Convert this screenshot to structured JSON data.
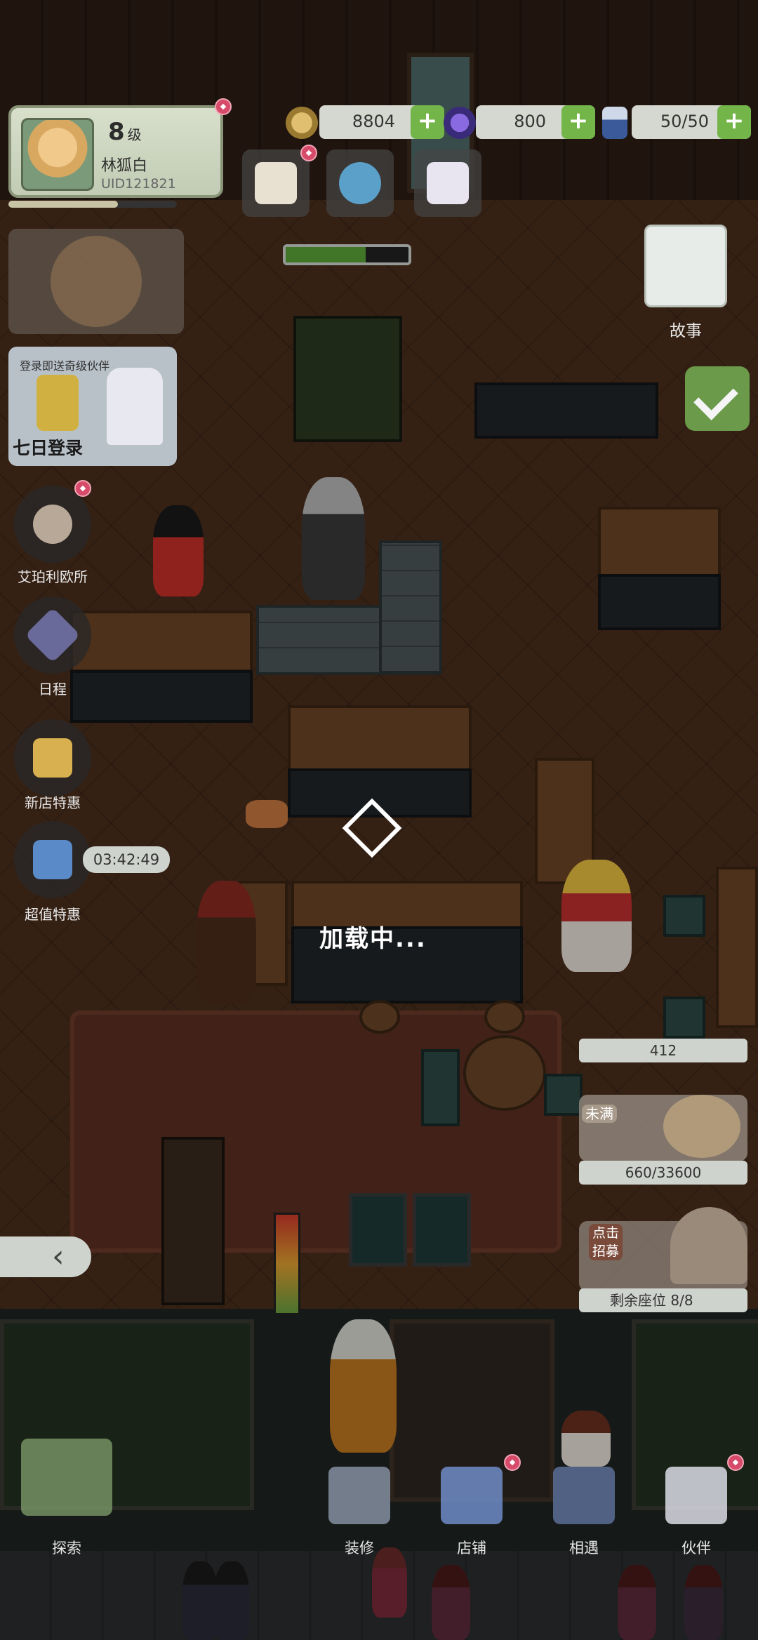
{
  "player": {
    "level_number": "8",
    "level_unit": "级",
    "name": "林狐白",
    "uid": "UID121821",
    "xp_fraction": 0.65
  },
  "resources": {
    "coins": "8804",
    "gems": "800",
    "energy": "50/50"
  },
  "quick_buttons": [
    "cats-icon",
    "chat-icon",
    "mail-icon"
  ],
  "left_menu": {
    "seven_day_banner_top": "登录即送奇级伙伴",
    "seven_day_label": "七日登录",
    "items": [
      {
        "label": "艾珀利欧所"
      },
      {
        "label": "日程"
      },
      {
        "label": "新店特惠"
      },
      {
        "label": "超值特惠"
      }
    ],
    "timer": "03:42:49"
  },
  "story": {
    "label": "故事"
  },
  "scene": {
    "loading_text": "加载中...",
    "stove_progress": 0.65
  },
  "shop_panel": {
    "top_value": "412",
    "status_tag": "未满",
    "savings": "660/33600",
    "recruit_tag": "点击招募",
    "seats": "剩余座位 8/8"
  },
  "bottom_nav": [
    {
      "label": "探索"
    },
    {
      "label": "装修"
    },
    {
      "label": "店铺"
    },
    {
      "label": "相遇"
    },
    {
      "label": "伙伴"
    }
  ],
  "colors": {
    "accent_green": "#74b54a",
    "badge_red": "#d64a6a",
    "panel_light": "#cfd3ce"
  }
}
